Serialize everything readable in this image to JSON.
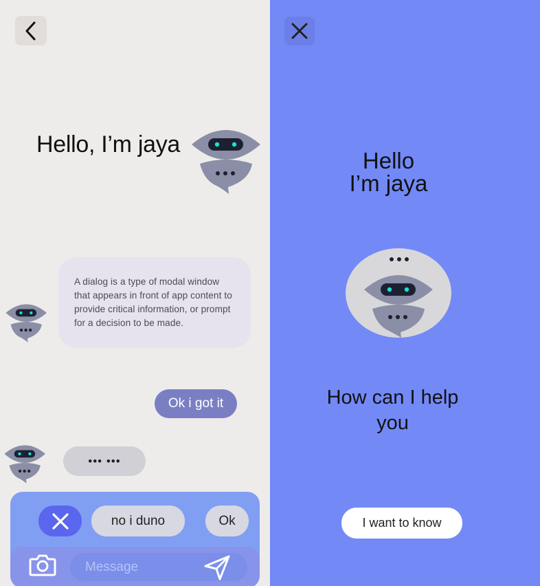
{
  "left_screen": {
    "back_icon": "chevron-left-icon",
    "greeting": "Hello, I’m jaya",
    "dialog_message": "A dialog is a type of modal window that appears in front of app content to provide critical information, or prompt for a decision to be made.",
    "user_reply": "Ok i got it",
    "typing_indicator": "••• •••",
    "quick_replies": {
      "dismiss_icon": "close-icon",
      "reply_1": "no i duno",
      "reply_2": "Ok"
    },
    "composer": {
      "camera_icon": "camera-icon",
      "placeholder": "Message",
      "send_icon": "send-icon"
    }
  },
  "right_screen": {
    "close_icon": "close-icon",
    "greeting_line_1": "Hello",
    "greeting_line_2": "I’m jaya",
    "question_line_1": "How can I help",
    "question_line_2": "you",
    "cta_button": "I want to know"
  },
  "colors": {
    "left_background": "#eeecea",
    "right_background": "#7389f6",
    "bot_body": "#8a8ea6",
    "bot_eye": "#17e3d6",
    "user_bubble": "#7a7fc4",
    "accent": "#5a66ee"
  }
}
